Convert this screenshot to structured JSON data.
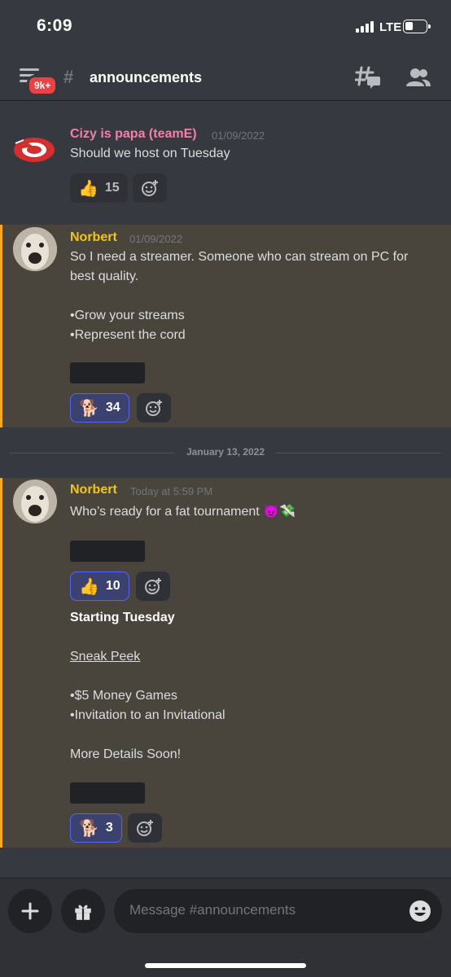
{
  "status": {
    "time": "6:09",
    "network": "LTE"
  },
  "header": {
    "badge": "9k+",
    "channel": "announcements"
  },
  "messages": [
    {
      "username": "Cizy is papa (teamE)",
      "username_color": "#f47fab",
      "timestamp": "01/09/2022",
      "lines": [
        "Should we host on Tuesday"
      ],
      "reaction": {
        "emoji": "👍",
        "count": "15"
      }
    },
    {
      "username": "Norbert",
      "username_color": "#f0c419",
      "timestamp": "01/09/2022",
      "lines": [
        "So I need a streamer. Someone who can stream on PC for",
        "best quality.",
        "•Grow your streams",
        "•Represent the cord"
      ],
      "reaction": {
        "emoji": "🐕",
        "count": "34"
      }
    },
    {
      "username": "Norbert",
      "username_color": "#f0c419",
      "timestamp": "Today at 5:59 PM",
      "line1": "Who’s ready for a fat tournament 😈💸",
      "reaction1": {
        "emoji": "👍",
        "count": "10"
      },
      "heading": "Starting Tuesday",
      "link": "Sneak Peek",
      "bullets": [
        "•$5 Money Games",
        "•Invitation to an Invitational"
      ],
      "footer": "More Details Soon!",
      "reaction2": {
        "emoji": "🐕",
        "count": "3"
      }
    }
  ],
  "divider": "January 13, 2022",
  "composer": {
    "placeholder": "Message #announcements"
  }
}
